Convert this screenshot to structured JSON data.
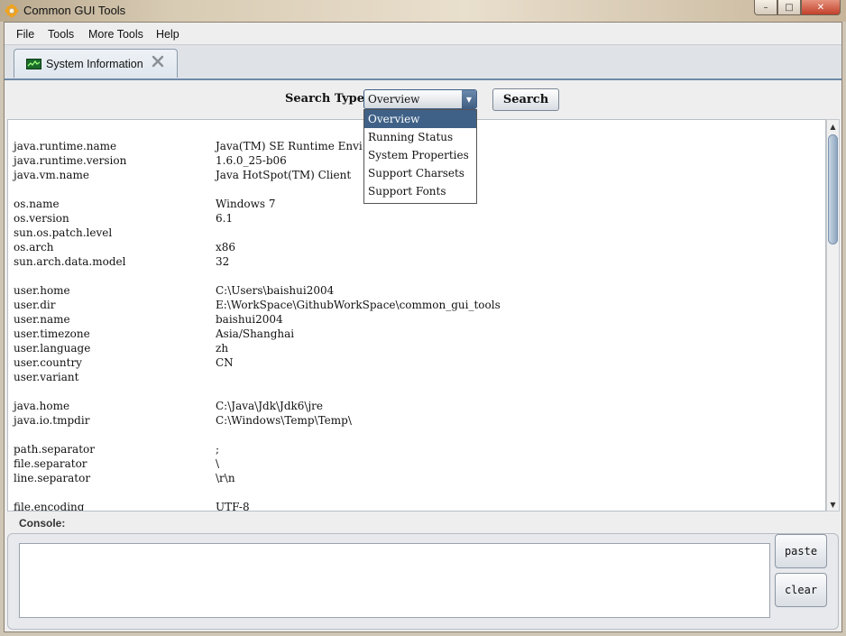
{
  "window": {
    "title": "Common GUI Tools",
    "controls": {
      "minimize": "–",
      "maximize": "□",
      "close": "✕"
    }
  },
  "menu": {
    "items": [
      "File",
      "Tools",
      "More Tools",
      "Help"
    ]
  },
  "tabs": [
    {
      "label": "System Information",
      "icon": "monitor-chart-icon"
    }
  ],
  "search": {
    "label": "Search Type:",
    "selected": "Overview",
    "button": "Search",
    "options": [
      "Overview",
      "Running Status",
      "System Properties",
      "Support Charsets",
      "Support Fonts"
    ]
  },
  "properties": [
    {
      "key": "java.runtime.name",
      "value": "Java(TM) SE Runtime Envi"
    },
    {
      "key": "java.runtime.version",
      "value": "1.6.0_25-b06"
    },
    {
      "key": "java.vm.name",
      "value": "Java HotSpot(TM) Client"
    },
    {
      "key": "os.name",
      "value": "Windows 7"
    },
    {
      "key": "os.version",
      "value": "6.1"
    },
    {
      "key": "sun.os.patch.level",
      "value": ""
    },
    {
      "key": "os.arch",
      "value": "x86"
    },
    {
      "key": "sun.arch.data.model",
      "value": "32"
    },
    {
      "key": "user.home",
      "value": "C:\\Users\\baishui2004"
    },
    {
      "key": "user.dir",
      "value": "E:\\WorkSpace\\GithubWorkSpace\\common_gui_tools"
    },
    {
      "key": "user.name",
      "value": "baishui2004"
    },
    {
      "key": "user.timezone",
      "value": "Asia/Shanghai"
    },
    {
      "key": "user.language",
      "value": "zh"
    },
    {
      "key": "user.country",
      "value": "CN"
    },
    {
      "key": "user.variant",
      "value": ""
    },
    {
      "key": "java.home",
      "value": "C:\\Java\\Jdk\\Jdk6\\jre"
    },
    {
      "key": "java.io.tmpdir",
      "value": "C:\\Windows\\Temp\\Temp\\"
    },
    {
      "key": "path.separator",
      "value": ";"
    },
    {
      "key": "file.separator",
      "value": "\\"
    },
    {
      "key": "line.separator",
      "value": "\\r\\n"
    },
    {
      "key": "file.encoding",
      "value": "UTF-8"
    }
  ],
  "console": {
    "label": "Console:",
    "value": "",
    "paste": "paste",
    "clear": "clear"
  },
  "colors": {
    "selection": "#3f6187",
    "tab_border": "#6f8aa8"
  }
}
